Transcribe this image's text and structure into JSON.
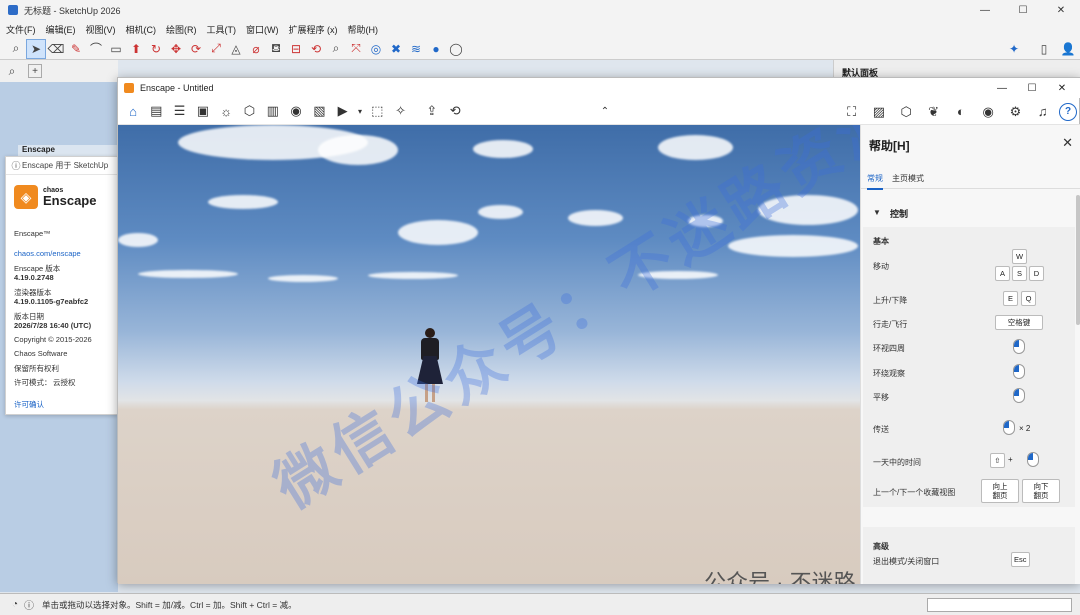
{
  "sketchup": {
    "title": "无标题 - SketchUp 2026",
    "window_buttons": [
      "—",
      "☐",
      "✕"
    ],
    "menu": [
      "文件(F)",
      "编辑(E)",
      "视图(V)",
      "相机(C)",
      "绘图(R)",
      "工具(T)",
      "窗口(W)",
      "扩展程序 (x)",
      "帮助(H)"
    ],
    "tray_title": "默认面板",
    "behind_tag": "Enscape",
    "status_text": "单击或拖动以选择对象。Shift = 加/减。Ctrl = 加。Shift + Ctrl = 减。"
  },
  "about": {
    "header": "Enscape 用于 SketchUp",
    "brand_small": "chaos",
    "brand_large": "Enscape",
    "product": "Enscape™",
    "link": "chaos.com/enscape",
    "version_label": "Enscape 版本",
    "version": "4.19.0.2748",
    "renderer_label": "渲染器版本",
    "renderer": "4.19.0.1105-g7eabfc2",
    "date_label": "版本日期",
    "date": "2026/7/28 16:40 (UTC)",
    "copyright": "Copyright © 2015-2026",
    "company": "Chaos Software",
    "rights": "保留所有权利",
    "license_label": "许可模式：",
    "license_value": "云授权",
    "license_link": "许可确认"
  },
  "enscape": {
    "title": "Enscape - Untitled",
    "window_buttons": [
      "—",
      "☐",
      "✕"
    ]
  },
  "watermark": {
    "diag": "微信公众号：不迷路资源库",
    "bottom": "公众号 · 不迷路资源库"
  },
  "help": {
    "title": "帮助[H]",
    "tab_general": "常规",
    "tab_home": "主页模式",
    "section_controls": "控制",
    "group_basic": "基本",
    "move": "移动",
    "keys_move": [
      "W",
      "A",
      "S",
      "D"
    ],
    "updown": "上升/下降",
    "keys_updown": [
      "E",
      "Q"
    ],
    "walkfly": "行走/飞行",
    "key_space": "空格键",
    "look_around": "环视四周",
    "orbit": "环绕观察",
    "pan": "平移",
    "teleport": "传送",
    "teleport_times": "× 2",
    "time_of_day": "一天中的时间",
    "plus": "+",
    "prev_next_view": "上一个/下一个收藏视图",
    "key_pageup": "向上\n翻页",
    "key_pagedown": "向下\n翻页",
    "group_advanced": "高级",
    "exit_mode": "退出模式/关闭窗口",
    "key_esc": "Esc"
  }
}
